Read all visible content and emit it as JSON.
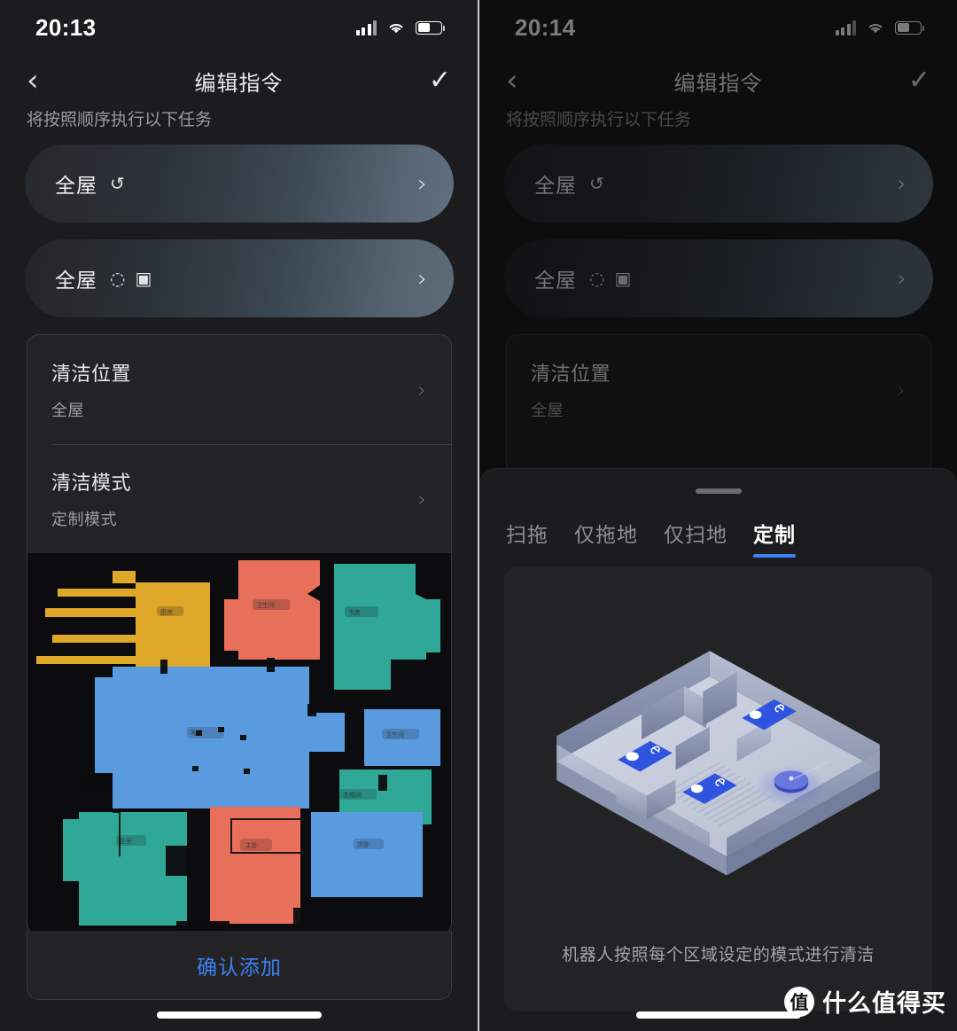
{
  "left": {
    "status": {
      "time": "20:13",
      "signal_icon": "cellular-signal-icon",
      "wifi_icon": "wifi-icon",
      "battery_icon": "battery-icon",
      "battery_level": 55
    },
    "nav": {
      "back_icon": "chevron-left-icon",
      "title": "编辑指令",
      "done_icon": "checkmark-icon"
    },
    "subtitle": "将按照顺序执行以下任务",
    "task_cards": [
      {
        "label": "全屋",
        "icons": [
          "↺"
        ],
        "chevron": "›"
      },
      {
        "label": "全屋",
        "icons": [
          "◌",
          "▣"
        ],
        "chevron": "›"
      }
    ],
    "settings": [
      {
        "title": "清洁位置",
        "value": "全屋",
        "chevron": "›"
      },
      {
        "title": "清洁模式",
        "value": "定制模式",
        "chevron": "›"
      }
    ],
    "confirm_label": "确认添加"
  },
  "right": {
    "status": {
      "time": "20:14",
      "signal_icon": "cellular-signal-icon",
      "wifi_icon": "wifi-icon",
      "battery_icon": "battery-icon",
      "battery_level": 55
    },
    "nav": {
      "back_icon": "chevron-left-icon",
      "title": "编辑指令",
      "done_icon": "checkmark-icon"
    },
    "subtitle": "将按照顺序执行以下任务",
    "task_cards": [
      {
        "label": "全屋",
        "icons": [
          "↺"
        ],
        "chevron": "›"
      },
      {
        "label": "全屋",
        "icons": [
          "◌",
          "▣"
        ],
        "chevron": "›"
      }
    ],
    "settings": [
      {
        "title": "清洁位置",
        "value": "全屋",
        "chevron": "›"
      }
    ],
    "sheet": {
      "handle": "drag-handle",
      "tabs": [
        {
          "label": "扫拖",
          "active": false
        },
        {
          "label": "仅拖地",
          "active": false
        },
        {
          "label": "仅扫地",
          "active": false
        },
        {
          "label": "定制",
          "active": true
        }
      ],
      "caption": "机器人按照每个区域设定的模式进行清洁"
    }
  },
  "watermark": {
    "logo": "值",
    "text": "什么值得买"
  },
  "colors": {
    "accent_blue": "#3b82f7",
    "screen_bg": "#1c1c1e",
    "card_bg": "#232325",
    "map_bg": "#0c0c0e",
    "room_yellow": "#e0a829",
    "room_coral": "#e8705a",
    "room_blue": "#5a9be0",
    "room_teal": "#2fa898"
  },
  "map": {
    "rooms": [
      {
        "name": "厨房",
        "color": "#e0a829"
      },
      {
        "name": "卫生间",
        "color": "#e8705a"
      },
      {
        "name": "书房",
        "color": "#2fa898"
      },
      {
        "name": "客厅",
        "color": "#5a9be0"
      },
      {
        "name": "卫生间2",
        "color": "#5a9be0"
      },
      {
        "name": "衣帽间",
        "color": "#2fa898"
      },
      {
        "name": "卧室",
        "color": "#2fa898"
      },
      {
        "name": "主卧",
        "color": "#e8705a"
      },
      {
        "name": "次卧",
        "color": "#5a9be0"
      }
    ]
  }
}
